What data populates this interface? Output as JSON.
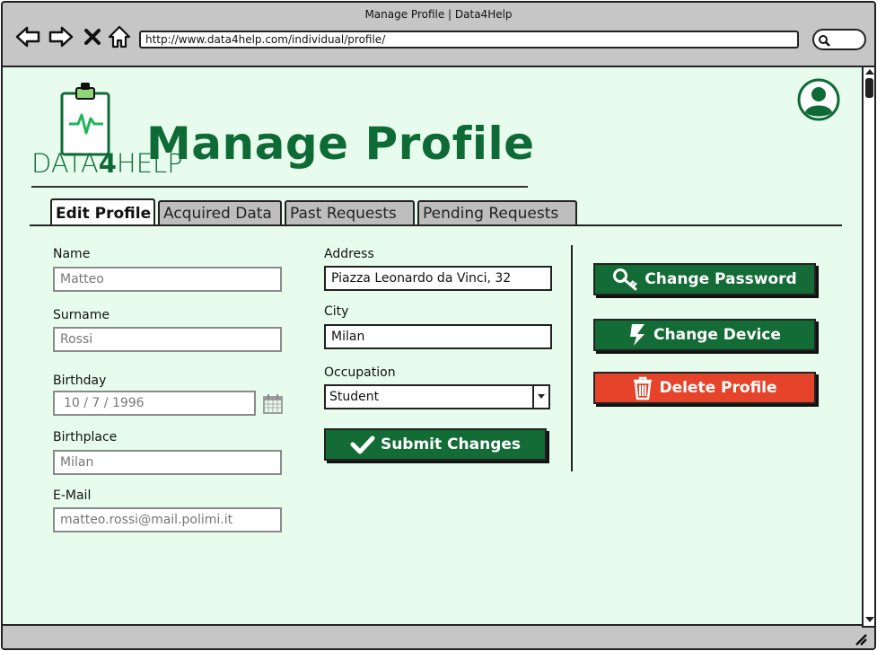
{
  "window": {
    "title": "Manage Profile | Data4Help",
    "url": "http://www.data4help.com/individual/profile/"
  },
  "header": {
    "logo_prefix": "DATA",
    "logo_number": "4",
    "logo_suffix": "HELP",
    "page_title": "Manage Profile"
  },
  "tabs": [
    {
      "label": "Edit Profile",
      "active": true
    },
    {
      "label": "Acquired Data",
      "active": false
    },
    {
      "label": "Past Requests",
      "active": false
    },
    {
      "label": "Pending Requests",
      "active": false
    }
  ],
  "form": {
    "name_label": "Name",
    "name_value": "Matteo",
    "surname_label": "Surname",
    "surname_value": "Rossi",
    "birthday_label": "Birthday",
    "birthday_value": "10 / 7 / 1996",
    "birthplace_label": "Birthplace",
    "birthplace_value": "Milan",
    "email_label": "E-Mail",
    "email_value": "matteo.rossi@mail.polimi.it",
    "address_label": "Address",
    "address_value": "Piazza Leonardo da Vinci, 32",
    "city_label": "City",
    "city_value": "Milan",
    "occupation_label": "Occupation",
    "occupation_value": "Student",
    "submit_label": "Submit Changes"
  },
  "actions": {
    "change_password_label": "Change Password",
    "change_device_label": "Change Device",
    "delete_profile_label": "Delete Profile"
  },
  "colors": {
    "brand_green": "#136b35",
    "danger_red": "#e5432a",
    "background_mint": "#e8fcee"
  }
}
